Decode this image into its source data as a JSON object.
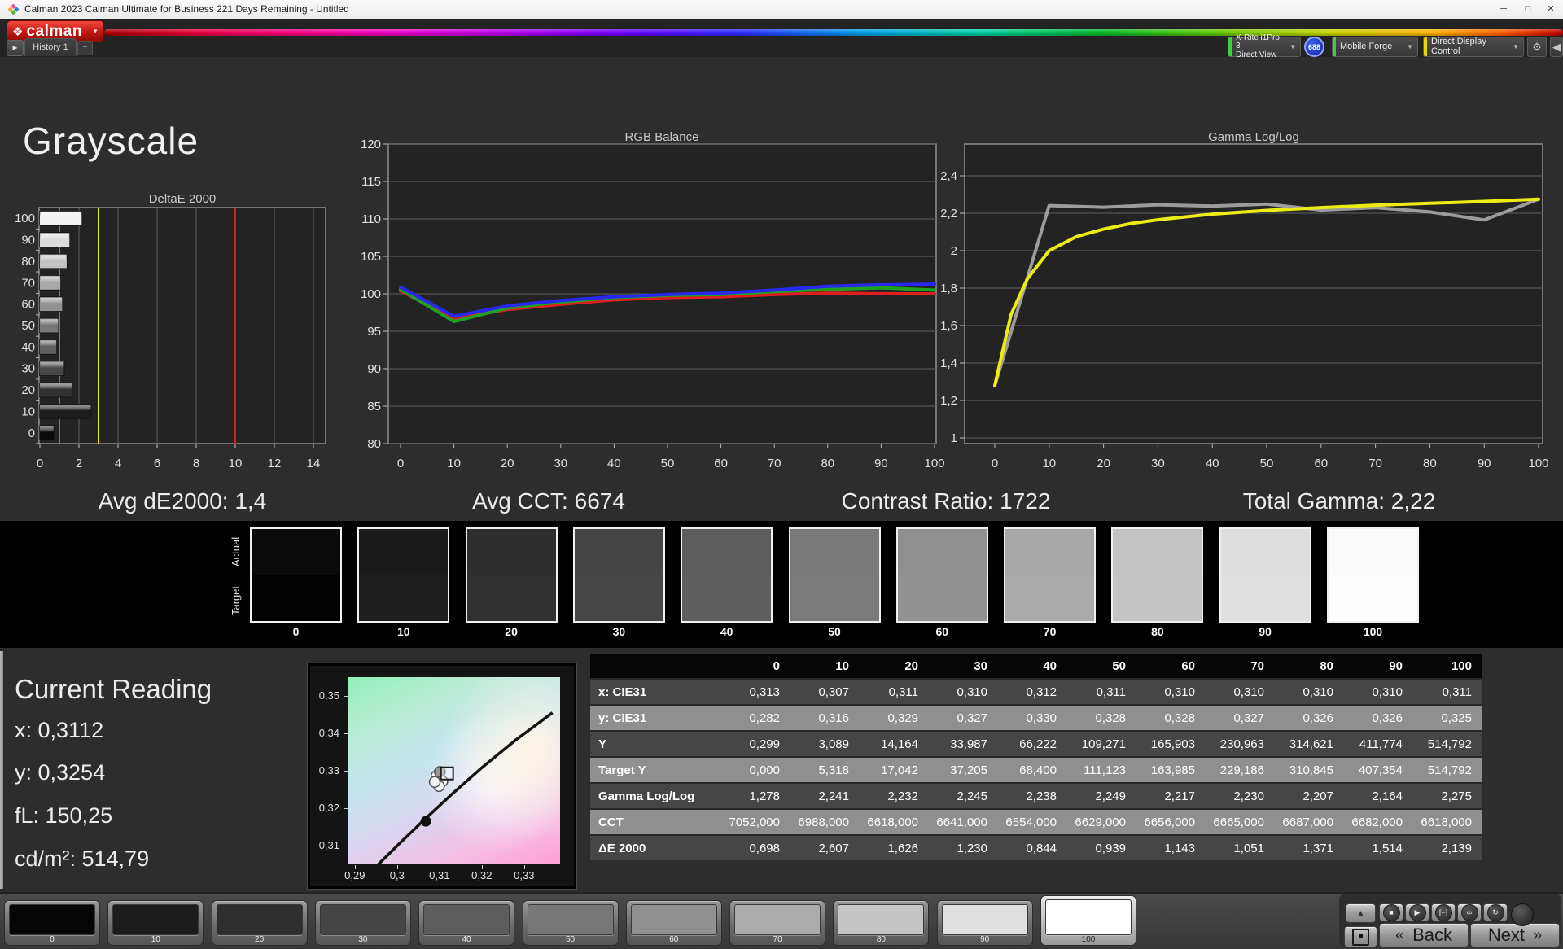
{
  "window": {
    "title": "Calman 2023 Calman Ultimate for Business 221 Days Remaining  - Untitled",
    "minimize": "─",
    "maximize": "□",
    "close": "✕"
  },
  "brand": {
    "logo_text": "calman",
    "logo_glyph": "❖",
    "caret": "▼"
  },
  "nav": {
    "back_arrow": "▶",
    "history_tab": "History 1",
    "add_tab": "+"
  },
  "meters": {
    "meter_line1": "X-Rite i1Pro 3",
    "meter_line2": "Direct View",
    "badge": "688",
    "source": "Mobile Forge",
    "display_control": "Direct Display Control",
    "caret": "▼",
    "gear": "⚙",
    "collapse": "◀",
    "meter_strip_color": "#3dd13d",
    "source_strip_color": "#3dd13d",
    "display_strip_color": "#e8d400"
  },
  "page": {
    "title": "Grayscale"
  },
  "stats": {
    "avg_de2000": "Avg dE2000: 1,4",
    "avg_cct": "Avg CCT: 6674",
    "contrast": "Contrast Ratio: 1722",
    "total_gamma": "Total Gamma: 2,22"
  },
  "chart_data": [
    {
      "id": "deltae",
      "type": "bar",
      "orientation": "horizontal",
      "title": "DeltaE 2000",
      "categories": [
        "100",
        "90",
        "80",
        "70",
        "60",
        "50",
        "40",
        "30",
        "20",
        "10",
        "0"
      ],
      "values": [
        2.139,
        1.514,
        1.371,
        1.051,
        1.143,
        0.939,
        0.844,
        1.23,
        1.626,
        2.607,
        0.698
      ],
      "bar_colors": [
        "#f2f2f2",
        "#dcdcdc",
        "#c3c3c3",
        "#aaaaaa",
        "#919191",
        "#787878",
        "#606060",
        "#484848",
        "#323232",
        "#1d1d1d",
        "#0b0b0b"
      ],
      "xticks": [
        "0",
        "2",
        "4",
        "6",
        "8",
        "10",
        "12",
        "14"
      ],
      "xlim": [
        0,
        14.65
      ],
      "grid": true,
      "ref_lines": [
        {
          "name": "target-good",
          "value": 1,
          "color": "#2fae2f"
        },
        {
          "name": "target-warn",
          "value": 3,
          "color": "#e9e900"
        },
        {
          "name": "target-bad",
          "value": 10,
          "color": "#d42020"
        }
      ]
    },
    {
      "id": "rgb_balance",
      "type": "line",
      "title": "RGB Balance",
      "x": [
        0,
        10,
        20,
        30,
        40,
        50,
        60,
        70,
        80,
        90,
        100
      ],
      "xticks": [
        "0",
        "10",
        "20",
        "30",
        "40",
        "50",
        "60",
        "70",
        "80",
        "90",
        "100"
      ],
      "yticks": [
        120,
        115,
        110,
        105,
        100,
        95,
        90,
        85,
        80
      ],
      "ylim": [
        80,
        120
      ],
      "grid": true,
      "series": [
        {
          "name": "Red",
          "color": "#de1f1f",
          "values": [
            100.4,
            96.7,
            97.9,
            98.6,
            99.2,
            99.5,
            99.6,
            99.9,
            100.1,
            100.0,
            100.0
          ]
        },
        {
          "name": "Green",
          "color": "#21a121",
          "values": [
            100.6,
            96.3,
            98.1,
            98.9,
            99.5,
            99.8,
            99.9,
            100.3,
            100.6,
            100.8,
            100.5
          ]
        },
        {
          "name": "Blue",
          "color": "#2828ee",
          "values": [
            100.9,
            97.0,
            98.4,
            99.1,
            99.6,
            99.9,
            100.1,
            100.5,
            101.0,
            101.2,
            101.3
          ]
        }
      ]
    },
    {
      "id": "gamma",
      "type": "line",
      "title": "Gamma Log/Log",
      "xticks": [
        "0",
        "10",
        "20",
        "30",
        "40",
        "50",
        "60",
        "70",
        "80",
        "90",
        "100"
      ],
      "ytick_labels": [
        "2,4",
        "2,2",
        "2",
        "1,8",
        "1,6",
        "1,4",
        "1,2",
        "1"
      ],
      "ytick_values": [
        2.4,
        2.2,
        2.0,
        1.8,
        1.6,
        1.4,
        1.2,
        1.0
      ],
      "ylim": [
        0.97,
        2.57
      ],
      "grid": true,
      "series": [
        {
          "name": "Measured",
          "color": "#9c9c9c",
          "x": [
            0,
            10,
            20,
            30,
            40,
            50,
            60,
            70,
            80,
            90,
            100
          ],
          "values": [
            1.278,
            2.241,
            2.232,
            2.245,
            2.238,
            2.249,
            2.217,
            2.23,
            2.207,
            2.164,
            2.275
          ]
        },
        {
          "name": "Target",
          "color": "#ecec12",
          "x": [
            0,
            3,
            6,
            10,
            15,
            20,
            25,
            30,
            40,
            50,
            60,
            70,
            80,
            90,
            100
          ],
          "values": [
            1.28,
            1.66,
            1.85,
            2.0,
            2.075,
            2.115,
            2.145,
            2.165,
            2.195,
            2.215,
            2.23,
            2.243,
            2.253,
            2.263,
            2.275
          ]
        }
      ]
    },
    {
      "id": "cie_detail",
      "type": "scatter",
      "title": "",
      "xtick_labels": [
        "0,29",
        "0,3",
        "0,31",
        "0,32",
        "0,33"
      ],
      "xtick_values": [
        0.29,
        0.3,
        0.31,
        0.32,
        0.33
      ],
      "ytick_labels": [
        "0,35",
        "0,34",
        "0,33",
        "0,32",
        "0,31"
      ],
      "ytick_values": [
        0.35,
        0.34,
        0.33,
        0.32,
        0.31
      ],
      "xlim": [
        0.2885,
        0.3385
      ],
      "ylim": [
        0.305,
        0.355
      ],
      "locus": [
        [
          0.2945,
          0.3038
        ],
        [
          0.3005,
          0.3105
        ],
        [
          0.3065,
          0.317
        ],
        [
          0.313,
          0.3238
        ],
        [
          0.32,
          0.3308
        ],
        [
          0.328,
          0.3382
        ],
        [
          0.3367,
          0.3455
        ]
      ],
      "blackbody_point": [
        0.3068,
        0.3165
      ],
      "measurements": [
        [
          0.3093,
          0.3286
        ],
        [
          0.3101,
          0.3297
        ],
        [
          0.3107,
          0.3272
        ],
        [
          0.3099,
          0.3259
        ],
        [
          0.3089,
          0.327
        ]
      ],
      "target_square": [
        0.3118,
        0.3293
      ]
    }
  ],
  "patches": {
    "row_labels": [
      "Actual",
      "Target"
    ],
    "levels": [
      {
        "label": "0",
        "actual": "#0b0b0b",
        "target": "#020202"
      },
      {
        "label": "10",
        "actual": "#1b1b1b",
        "target": "#1f1f1f"
      },
      {
        "label": "20",
        "actual": "#2e2e2e",
        "target": "#313131"
      },
      {
        "label": "30",
        "actual": "#454545",
        "target": "#474747"
      },
      {
        "label": "40",
        "actual": "#5d5d5d",
        "target": "#5f5f5f"
      },
      {
        "label": "50",
        "actual": "#797979",
        "target": "#7a7a7a"
      },
      {
        "label": "60",
        "actual": "#8f8f8f",
        "target": "#929292"
      },
      {
        "label": "70",
        "actual": "#a8a8a8",
        "target": "#aaaaaa"
      },
      {
        "label": "80",
        "actual": "#c2c2c2",
        "target": "#c4c4c4"
      },
      {
        "label": "90",
        "actual": "#dddddd",
        "target": "#dfdfdf"
      },
      {
        "label": "100",
        "actual": "#fafafa",
        "target": "#fdfdfd"
      }
    ]
  },
  "current_reading": {
    "title": "Current Reading",
    "x": "x: 0,3112",
    "y": "y: 0,3254",
    "fl": "fL: 150,25",
    "cdm2": "cd/m²: 514,79"
  },
  "table": {
    "col_headers": [
      "0",
      "10",
      "20",
      "30",
      "40",
      "50",
      "60",
      "70",
      "80",
      "90",
      "100"
    ],
    "rows": [
      {
        "label": "x: CIE31",
        "shade": "dark",
        "values": [
          "0,313",
          "0,307",
          "0,311",
          "0,310",
          "0,312",
          "0,311",
          "0,310",
          "0,310",
          "0,310",
          "0,310",
          "0,311"
        ]
      },
      {
        "label": "y: CIE31",
        "shade": "light",
        "values": [
          "0,282",
          "0,316",
          "0,329",
          "0,327",
          "0,330",
          "0,328",
          "0,328",
          "0,327",
          "0,326",
          "0,326",
          "0,325"
        ]
      },
      {
        "label": "Y",
        "shade": "dark",
        "values": [
          "0,299",
          "3,089",
          "14,164",
          "33,987",
          "66,222",
          "109,271",
          "165,903",
          "230,963",
          "314,621",
          "411,774",
          "514,792"
        ]
      },
      {
        "label": "Target Y",
        "shade": "light",
        "values": [
          "0,000",
          "5,318",
          "17,042",
          "37,205",
          "68,400",
          "111,123",
          "163,985",
          "229,186",
          "310,845",
          "407,354",
          "514,792"
        ]
      },
      {
        "label": "Gamma Log/Log",
        "shade": "dark",
        "values": [
          "1,278",
          "2,241",
          "2,232",
          "2,245",
          "2,238",
          "2,249",
          "2,217",
          "2,230",
          "2,207",
          "2,164",
          "2,275"
        ]
      },
      {
        "label": "CCT",
        "shade": "light",
        "values": [
          "7052,000",
          "6988,000",
          "6618,000",
          "6641,000",
          "6554,000",
          "6629,000",
          "6656,000",
          "6665,000",
          "6687,000",
          "6682,000",
          "6618,000"
        ]
      },
      {
        "label": "ΔE 2000",
        "shade": "dark",
        "values": [
          "0,698",
          "2,607",
          "1,626",
          "1,230",
          "0,844",
          "0,939",
          "1,143",
          "1,051",
          "1,371",
          "1,514",
          "2,139"
        ]
      }
    ]
  },
  "bottom_bar": {
    "levels": [
      {
        "label": "0",
        "color": "#060606"
      },
      {
        "label": "10",
        "color": "#1c1c1c"
      },
      {
        "label": "20",
        "color": "#2f2f2f"
      },
      {
        "label": "30",
        "color": "#454545"
      },
      {
        "label": "40",
        "color": "#5d5d5d"
      },
      {
        "label": "50",
        "color": "#777777"
      },
      {
        "label": "60",
        "color": "#919191"
      },
      {
        "label": "70",
        "color": "#ababab"
      },
      {
        "label": "80",
        "color": "#c5c5c5"
      },
      {
        "label": "90",
        "color": "#dfdfdf"
      },
      {
        "label": "100",
        "color": "#ffffff"
      }
    ],
    "panel_up": "▲",
    "display_square": "■",
    "transport": [
      {
        "name": "stop-icon",
        "glyph": "■"
      },
      {
        "name": "play-icon",
        "glyph": "▶"
      },
      {
        "name": "step-icon",
        "glyph": "[−]"
      },
      {
        "name": "loop-icon",
        "glyph": "∞"
      },
      {
        "name": "refresh-icon",
        "glyph": "↻"
      }
    ],
    "prev_chevron": "«",
    "back_label": "Back",
    "next_label": "Next",
    "next_chevron": "»"
  }
}
